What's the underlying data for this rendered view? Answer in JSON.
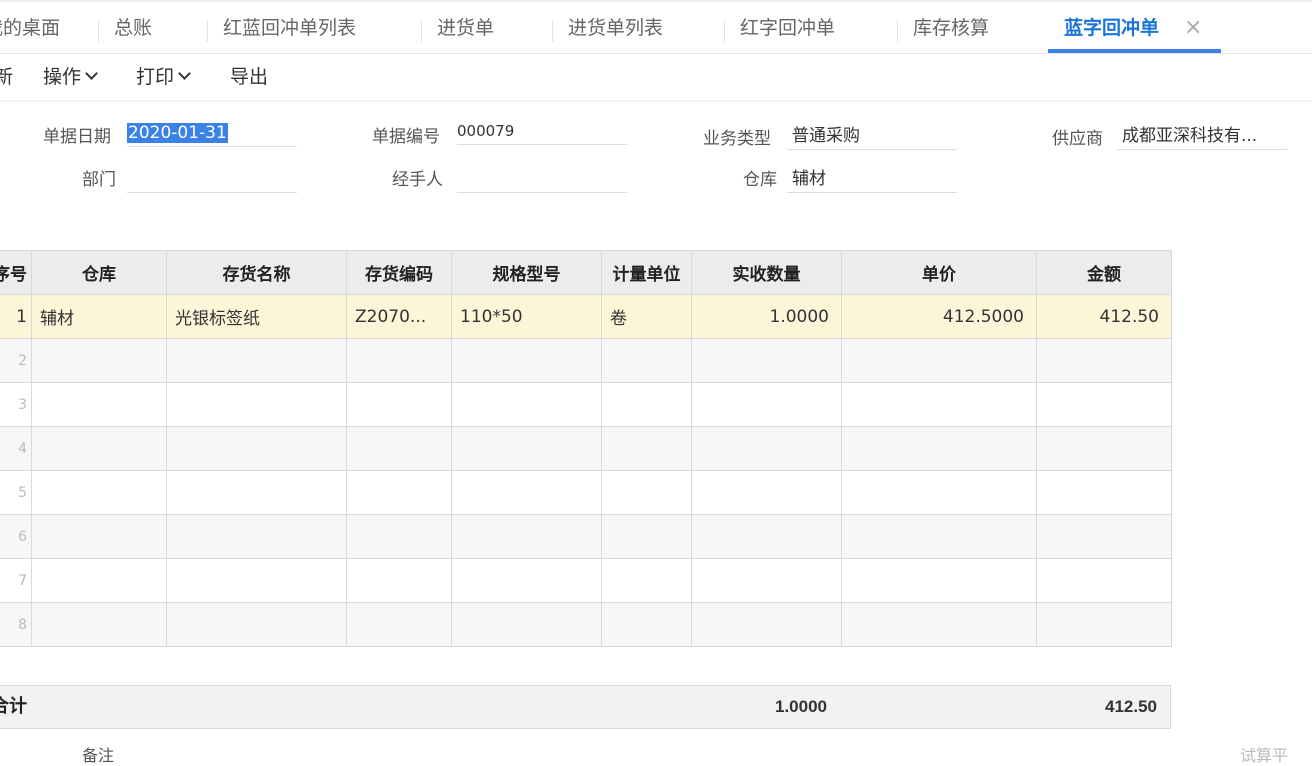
{
  "tabs": [
    {
      "label": "我的桌面"
    },
    {
      "label": "总账"
    },
    {
      "label": "红蓝回冲单列表"
    },
    {
      "label": "进货单"
    },
    {
      "label": "进货单列表"
    },
    {
      "label": "红字回冲单"
    },
    {
      "label": "库存核算"
    },
    {
      "label": "蓝字回冲单",
      "active": true
    }
  ],
  "tab_close_icon": "×",
  "toolbar": {
    "refresh": "新",
    "operate": "操作",
    "print": "打印",
    "export": "导出"
  },
  "form": {
    "doc_date_label": "单据日期",
    "doc_date_value": "2020-01-31",
    "doc_no_label": "单据编号",
    "doc_no_value": "000079",
    "biz_type_label": "业务类型",
    "biz_type_value": "普通采购",
    "supplier_label": "供应商",
    "supplier_value": "成都亚深科技有...",
    "dept_label": "部门",
    "dept_value": "",
    "handler_label": "经手人",
    "handler_value": "",
    "warehouse_label": "仓库",
    "warehouse_value": "辅材"
  },
  "grid": {
    "columns": [
      "序号",
      "仓库",
      "存货名称",
      "存货编码",
      "规格型号",
      "计量单位",
      "实收数量",
      "单价",
      "金额"
    ],
    "rows": [
      [
        "1",
        "辅材",
        "光银标签纸",
        "Z2070...",
        "110*50",
        "卷",
        "1.0000",
        "412.5000",
        "412.50"
      ],
      [
        "2",
        "",
        "",
        "",
        "",
        "",
        "",
        "",
        ""
      ],
      [
        "3",
        "",
        "",
        "",
        "",
        "",
        "",
        "",
        ""
      ],
      [
        "4",
        "",
        "",
        "",
        "",
        "",
        "",
        "",
        ""
      ],
      [
        "5",
        "",
        "",
        "",
        "",
        "",
        "",
        "",
        ""
      ],
      [
        "6",
        "",
        "",
        "",
        "",
        "",
        "",
        "",
        ""
      ],
      [
        "7",
        "",
        "",
        "",
        "",
        "",
        "",
        "",
        ""
      ],
      [
        "8",
        "",
        "",
        "",
        "",
        "",
        "",
        "",
        ""
      ]
    ]
  },
  "totals": {
    "label": "合计",
    "qty": "1.0000",
    "amount": "412.50"
  },
  "footer": {
    "remark_label": "备注",
    "right_text": "试算平"
  },
  "colors": {
    "accent": "#3b82e6",
    "active_tab_text": "#1a73d9",
    "highlight_row": "#fdf5d8",
    "header_bg": "#ececec"
  }
}
